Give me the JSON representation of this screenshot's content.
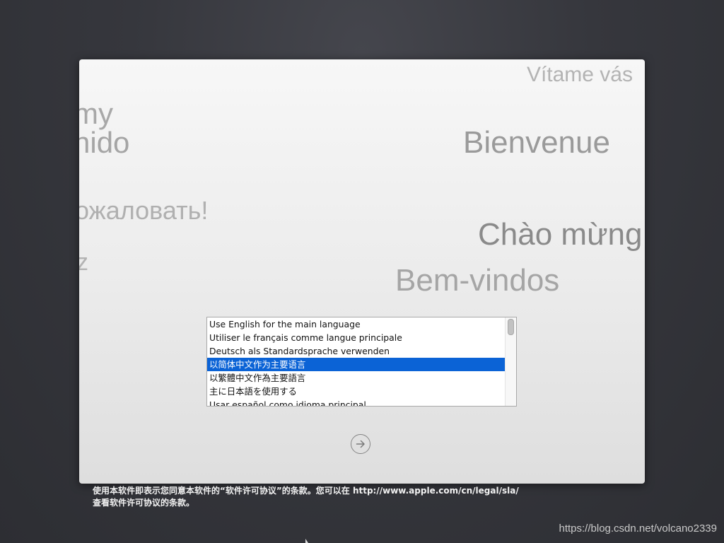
{
  "greetings": {
    "vitame": "Vítame vás",
    "my": "my",
    "nido": "nido",
    "bienvenue": "Bienvenue",
    "ru": "ожаловать!",
    "chao": "Chào mừng",
    "z": "z",
    "bem": "Bem-vindos"
  },
  "language_list": {
    "items": [
      "Use English for the main language",
      "Utiliser le français comme langue principale",
      "Deutsch als Standardsprache verwenden",
      "以简体中文作为主要语言",
      "以繁體中文作為主要語言",
      "主に日本語を使用する",
      "Usar español como idioma principal"
    ],
    "selected_index": 3
  },
  "continue_button": {
    "icon": "arrow-right-circle-icon"
  },
  "legal": {
    "line1": "使用本软件即表示您同意本软件的“软件许可协议”的条款。您可以在 http://www.apple.com/cn/legal/sla/",
    "line2": "查看软件许可协议的条款。"
  },
  "watermark": "https://blog.csdn.net/volcano2339",
  "colors": {
    "selection": "#0b63d6",
    "window_bg": "#eeeeee",
    "desktop_bg": "#36373d"
  }
}
